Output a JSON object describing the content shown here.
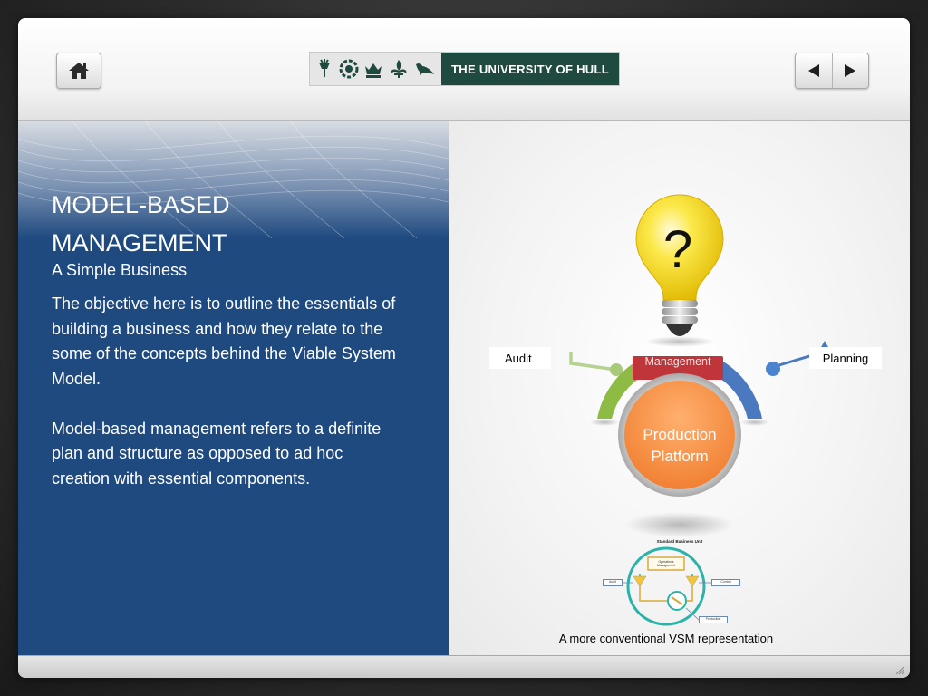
{
  "header": {
    "home_button_label": "Home",
    "logo_text": "THE UNIVERSITY OF HULL",
    "prev_button_label": "Previous slide",
    "next_button_label": "Next slide"
  },
  "slide": {
    "title": "MODEL-BASED\nMANAGEMENT",
    "subtitle": "A Simple Business",
    "paragraphs": [
      "The objective here is to outline the essentials of building a business and how they relate to the some of the concepts behind the Viable System Model.",
      "Model-based management refers to a definite plan and structure as opposed to ad hoc creation with essential components."
    ]
  },
  "diagram": {
    "question_mark": "?",
    "audit_label": "Audit",
    "planning_label": "Planning",
    "management_label": "Management",
    "platform_label": "Production Platform",
    "colors": {
      "bulb": "#f7d800",
      "audit_arc": "#8dbb44",
      "planning_arc": "#4a79c0",
      "management_bar": "#c0353a",
      "platform": "#f79046"
    }
  },
  "vsm": {
    "title": "Standard Business Unit",
    "management_box": "Operations Management",
    "audit_box": "Audit",
    "control_box": "Control",
    "production_box": "Production",
    "caption": "A more conventional VSM representation"
  },
  "icons": [
    "home-icon",
    "arrow-left-icon",
    "arrow-right-icon",
    "lightbulb-icon",
    "resize-grip-icon"
  ]
}
